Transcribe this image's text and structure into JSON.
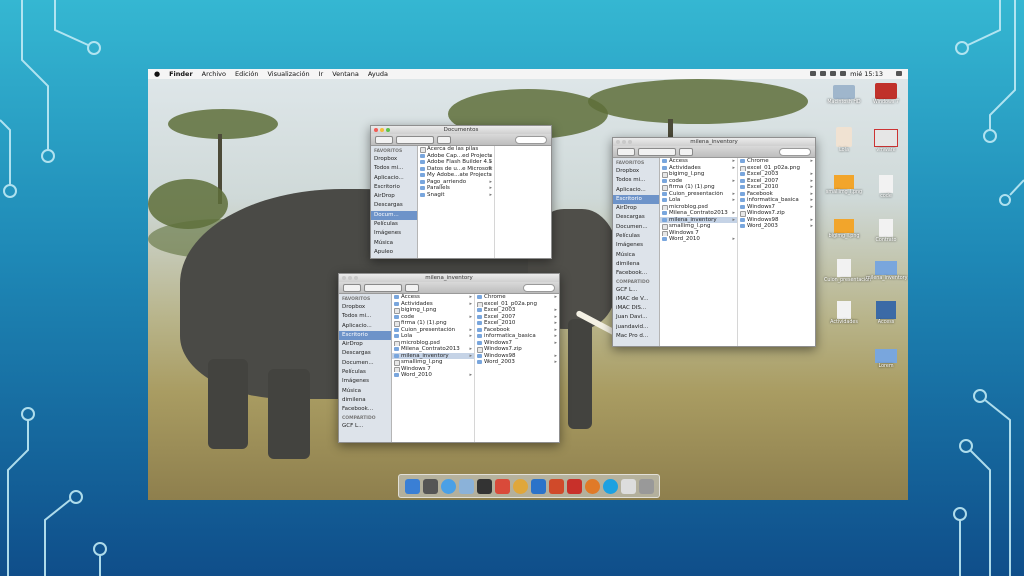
{
  "menubar": {
    "apple": "",
    "items": [
      "Finder",
      "Archivo",
      "Edición",
      "Visualización",
      "Ir",
      "Ventana",
      "Ayuda"
    ],
    "clock": "mié 15:13"
  },
  "window_documentos": {
    "title": "Documentos",
    "favorites_header": "FAVORITOS",
    "sidebar": [
      "Dropbox",
      "Todos mi...",
      "Aplicacio...",
      "Escritorio",
      "AirDrop",
      "Descargas",
      "Docum...",
      "Películas",
      "Imágenes",
      "Música",
      "Apuleo"
    ],
    "files": [
      "Acerca de las pilas",
      "Adobe Cap...ed Projects",
      "Adobe Flash Builder 4.5",
      "Datos de u...e Microsoft",
      "My Adobe...ate Projects",
      "Pago_arriendo",
      "Parallels",
      "Snagit"
    ]
  },
  "window_milena_1": {
    "title": "milena_inventory",
    "favorites_header": "FAVORITOS",
    "sidebar": [
      "Dropbox",
      "Todos mi...",
      "Aplicacio...",
      "Escritorio",
      "AirDrop",
      "Descargas",
      "Documen...",
      "Películas",
      "Imágenes",
      "Música",
      "dimilena",
      "Facebook..."
    ],
    "shared_header": "COMPARTIDO",
    "shared": [
      "GCF L...",
      "iMAC de V...",
      "iMAC DIS...",
      "Juan Davi...",
      "juandavid...",
      "Mac Pro d..."
    ],
    "col1": [
      "Access",
      "Actividades",
      "bigimg_l.png",
      "code",
      "firma (1) (1).png",
      "Cuion_presentación",
      "Lola",
      "microblog.psd",
      "Milena_Contrato2013",
      "milena_inventory",
      "smallimg_l.png",
      "Windows 7",
      "Word_2010"
    ],
    "col2": [
      "Chrome",
      "excel_01_p02a.png",
      "Excel_2003",
      "Excel_2007",
      "Excel_2010",
      "Facebook",
      "informatica_basica",
      "Windows7",
      "Windows7.zip",
      "Windows98",
      "Word_2003"
    ]
  },
  "window_milena_2": {
    "title": "milena_inventory",
    "favorites_header": "FAVORITOS",
    "sidebar": [
      "Dropbox",
      "Todos mi...",
      "Aplicacio...",
      "Escritorio",
      "AirDrop",
      "Descargas",
      "Documen...",
      "Películas",
      "Imágenes",
      "Música",
      "dimilena",
      "Facebook..."
    ],
    "shared_header": "COMPARTIDO",
    "shared": [
      "GCF L..."
    ],
    "col1": [
      "Access",
      "Actividades",
      "bigimg_l.png",
      "code",
      "firma (1) (1).png",
      "Cuion_presentación",
      "Lola",
      "microblog.psd",
      "Milena_Contrato2013",
      "milena_inventory",
      "smallimg_l.png",
      "Windows 7",
      "Word_2010"
    ],
    "col2": [
      "Chrome",
      "excel_01_p02a.png",
      "Excel_2003",
      "Excel_2007",
      "Excel_2010",
      "Facebook",
      "informatica_basica",
      "Windows7",
      "Windows7.zip",
      "Windows98",
      "Word_2003"
    ]
  },
  "desktop_icons": [
    "Macintosh HD",
    "Windows 7",
    "Lola",
    "vmware",
    "smallimg_l.png",
    "code",
    "bigimg_l.png",
    "Contrato",
    "Cuion_presentación",
    "milena_inventory",
    "Actividades",
    "Access",
    "Lorem"
  ],
  "colors": {
    "selection": "#6d93c9",
    "folder": "#79a6dd"
  }
}
